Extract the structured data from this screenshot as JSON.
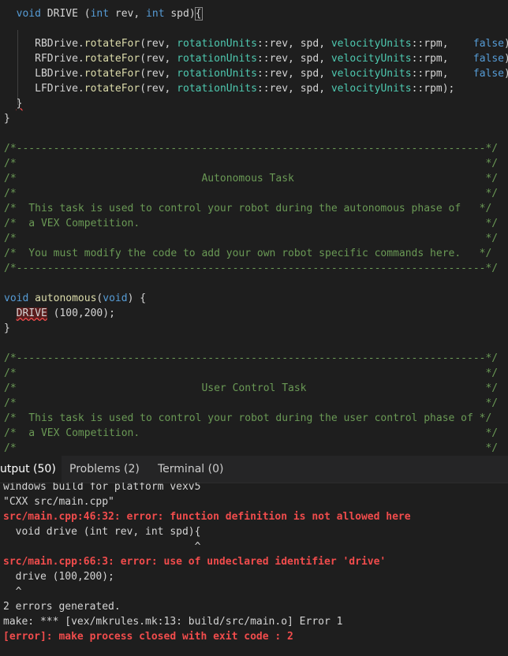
{
  "editor": {
    "lines": [
      [
        {
          "t": "  ",
          "c": "tx"
        },
        {
          "t": "void",
          "c": "kw"
        },
        {
          "t": " DRIVE (",
          "c": "tx"
        },
        {
          "t": "int",
          "c": "kw"
        },
        {
          "t": " rev, ",
          "c": "tx"
        },
        {
          "t": "int",
          "c": "kw"
        },
        {
          "t": " spd)",
          "c": "tx"
        },
        {
          "t": "{",
          "c": "hl"
        }
      ],
      [],
      [
        {
          "t": "     RBDrive.",
          "c": "tx"
        },
        {
          "t": "rotateFor",
          "c": "fn"
        },
        {
          "t": "(rev, ",
          "c": "tx"
        },
        {
          "t": "rotationUnits",
          "c": "ty"
        },
        {
          "t": "::rev, spd, ",
          "c": "tx"
        },
        {
          "t": "velocityUnits",
          "c": "ty"
        },
        {
          "t": "::rpm,    ",
          "c": "tx"
        },
        {
          "t": "false",
          "c": "kw"
        },
        {
          "t": ");",
          "c": "tx"
        }
      ],
      [
        {
          "t": "     RFDrive.",
          "c": "tx"
        },
        {
          "t": "rotateFor",
          "c": "fn"
        },
        {
          "t": "(rev, ",
          "c": "tx"
        },
        {
          "t": "rotationUnits",
          "c": "ty"
        },
        {
          "t": "::rev, spd, ",
          "c": "tx"
        },
        {
          "t": "velocityUnits",
          "c": "ty"
        },
        {
          "t": "::rpm,    ",
          "c": "tx"
        },
        {
          "t": "false",
          "c": "kw"
        },
        {
          "t": ");",
          "c": "tx"
        }
      ],
      [
        {
          "t": "     LBDrive.",
          "c": "tx"
        },
        {
          "t": "rotateFor",
          "c": "fn"
        },
        {
          "t": "(rev, ",
          "c": "tx"
        },
        {
          "t": "rotationUnits",
          "c": "ty"
        },
        {
          "t": "::rev, spd, ",
          "c": "tx"
        },
        {
          "t": "velocityUnits",
          "c": "ty"
        },
        {
          "t": "::rpm,    ",
          "c": "tx"
        },
        {
          "t": "false",
          "c": "kw"
        },
        {
          "t": ");",
          "c": "tx"
        }
      ],
      [
        {
          "t": "     LFDrive.",
          "c": "tx"
        },
        {
          "t": "rotateFor",
          "c": "fn"
        },
        {
          "t": "(rev, ",
          "c": "tx"
        },
        {
          "t": "rotationUnits",
          "c": "ty"
        },
        {
          "t": "::rev, spd, ",
          "c": "tx"
        },
        {
          "t": "velocityUnits",
          "c": "ty"
        },
        {
          "t": "::rpm);",
          "c": "tx"
        }
      ],
      [
        {
          "t": "  ",
          "c": "tx"
        },
        {
          "t": "}",
          "c": "err"
        }
      ],
      [
        {
          "t": "}",
          "c": "tx"
        }
      ],
      [],
      [
        {
          "t": "/*----------------------------------------------------------------------------*/",
          "c": "cm"
        }
      ],
      [
        {
          "t": "/*                                                                            */",
          "c": "cm"
        }
      ],
      [
        {
          "t": "/*                              Autonomous Task                               */",
          "c": "cm"
        }
      ],
      [
        {
          "t": "/*                                                                            */",
          "c": "cm"
        }
      ],
      [
        {
          "t": "/*  This task is used to control your robot during the autonomous phase of   */",
          "c": "cm"
        }
      ],
      [
        {
          "t": "/*  a VEX Competition.                                                        */",
          "c": "cm"
        }
      ],
      [
        {
          "t": "/*                                                                            */",
          "c": "cm"
        }
      ],
      [
        {
          "t": "/*  You must modify the code to add your own robot specific commands here.   */",
          "c": "cm"
        }
      ],
      [
        {
          "t": "/*----------------------------------------------------------------------------*/",
          "c": "cm"
        }
      ],
      [],
      [
        {
          "t": "void",
          "c": "kw"
        },
        {
          "t": " ",
          "c": "tx"
        },
        {
          "t": "autonomous",
          "c": "fn"
        },
        {
          "t": "(",
          "c": "tx"
        },
        {
          "t": "void",
          "c": "kw"
        },
        {
          "t": ") {",
          "c": "tx"
        }
      ],
      [
        {
          "t": "  ",
          "c": "tx"
        },
        {
          "t": "DRIVE",
          "c": "errhl"
        },
        {
          "t": " (100,200);",
          "c": "tx"
        }
      ],
      [
        {
          "t": "}",
          "c": "tx"
        }
      ],
      [],
      [
        {
          "t": "/*----------------------------------------------------------------------------*/",
          "c": "cm"
        }
      ],
      [
        {
          "t": "/*                                                                            */",
          "c": "cm"
        }
      ],
      [
        {
          "t": "/*                              User Control Task                             */",
          "c": "cm"
        }
      ],
      [
        {
          "t": "/*                                                                            */",
          "c": "cm"
        }
      ],
      [
        {
          "t": "/*  This task is used to control your robot during the user control phase of */",
          "c": "cm"
        }
      ],
      [
        {
          "t": "/*  a VEX Competition.                                                        */",
          "c": "cm"
        }
      ],
      [
        {
          "t": "/*                                                                            */",
          "c": "cm"
        }
      ]
    ]
  },
  "panel": {
    "tabs": [
      {
        "label": "utput (50)",
        "active": true
      },
      {
        "label": "Problems (2)",
        "active": false
      },
      {
        "label": "Terminal (0)",
        "active": false
      }
    ],
    "output": [
      {
        "text": "windows build for platform vexv5",
        "error": false
      },
      {
        "text": "\"CXX src/main.cpp\"",
        "error": false
      },
      {
        "text": "src/main.cpp:46:32: error: function definition is not allowed here",
        "error": true
      },
      {
        "text": "  void drive (int rev, int spd){",
        "error": false
      },
      {
        "text": "                               ^",
        "error": false
      },
      {
        "text": "src/main.cpp:66:3: error: use of undeclared identifier 'drive'",
        "error": true
      },
      {
        "text": "  drive (100,200);",
        "error": false
      },
      {
        "text": "  ^",
        "error": false
      },
      {
        "text": "2 errors generated.",
        "error": false
      },
      {
        "text": "make: *** [vex/mkrules.mk:13: build/src/main.o] Error 1",
        "error": false
      },
      {
        "text": "[error]: make process closed with exit code : 2",
        "error": true
      }
    ]
  },
  "colors": {
    "background": "#1e1e1e",
    "keyword": "#569cd6",
    "function": "#dcdcaa",
    "type": "#4ec9b0",
    "comment": "#6a9955",
    "error": "#f14c4c"
  }
}
